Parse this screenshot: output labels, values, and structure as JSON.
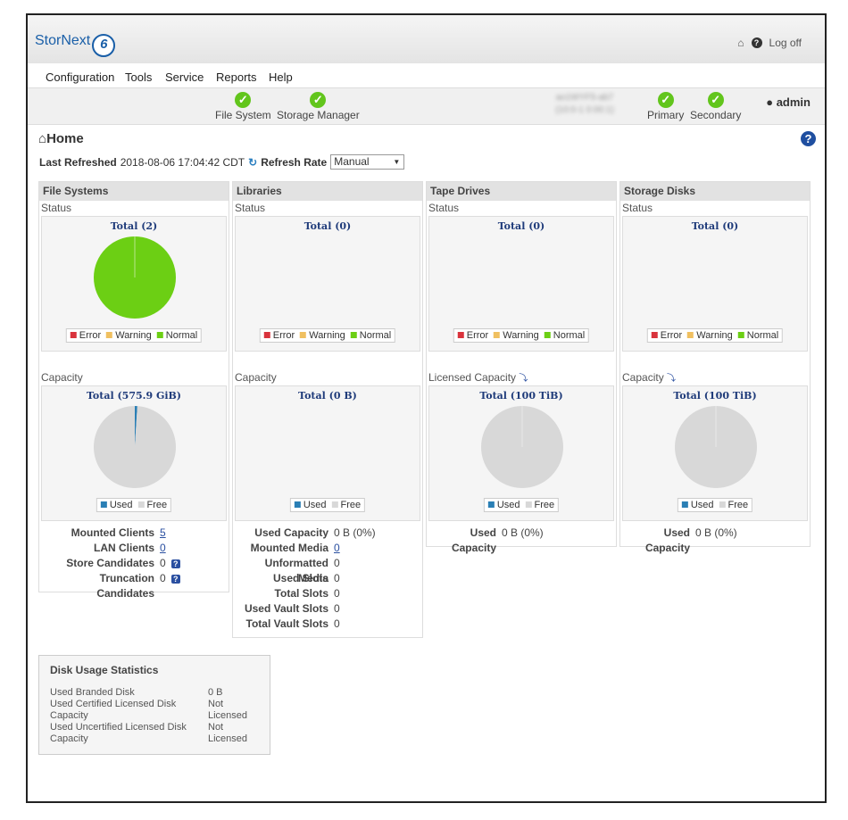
{
  "header": {
    "logo": "StorNext",
    "logo_badge": "6",
    "logoff": "Log off"
  },
  "menu": [
    "Configuration",
    "Tools",
    "Service",
    "Reports",
    "Help"
  ],
  "status": {
    "left": [
      "File System",
      "Storage Manager"
    ],
    "blurred_1": "ao1WYF5-ab7",
    "blurred_2": "(10:0-1 0:00:1)",
    "right": [
      "Primary",
      "Secondary"
    ],
    "user": "admin"
  },
  "page": {
    "title": "Home",
    "last_refreshed_label": "Last Refreshed",
    "last_refreshed": "2018-08-06 17:04:42 CDT",
    "refresh_rate_label": "Refresh Rate",
    "refresh_rate": "Manual"
  },
  "legends": {
    "error": "Error",
    "warning": "Warning",
    "normal": "Normal",
    "used": "Used",
    "free": "Free"
  },
  "colors": {
    "error": "#d9333c",
    "warning": "#f0c060",
    "normal": "#6ccf14",
    "used": "#2a7fb5",
    "free": "#d8d8d8"
  },
  "panels": [
    {
      "title": "File Systems",
      "status_label": "Status",
      "status_total": "Total (2)",
      "capacity_label": "Capacity",
      "capacity_total": "Total (575.9 GiB)",
      "stats": [
        {
          "k": "Mounted Clients",
          "v": "5",
          "link": true
        },
        {
          "k": "LAN Clients",
          "v": "0",
          "link": true
        },
        {
          "k": "Store Candidates",
          "v": "0",
          "help": true
        },
        {
          "k": "Truncation Candidates",
          "v": "0",
          "help": true
        }
      ]
    },
    {
      "title": "Libraries",
      "status_label": "Status",
      "status_total": "Total (0)",
      "capacity_label": "Capacity",
      "capacity_total": "Total (0 B)",
      "stats": [
        {
          "k": "Used Capacity",
          "v": "0 B (0%)"
        },
        {
          "k": "Mounted Media",
          "v": "0",
          "link": true
        },
        {
          "k": "Unformatted Media",
          "v": "0"
        },
        {
          "k": "Used Slots",
          "v": "0"
        },
        {
          "k": "Total Slots",
          "v": "0"
        },
        {
          "k": "Used Vault Slots",
          "v": "0"
        },
        {
          "k": "Total Vault Slots",
          "v": "0"
        }
      ]
    },
    {
      "title": "Tape Drives",
      "status_label": "Status",
      "status_total": "Total (0)",
      "capacity_label": "Licensed Capacity",
      "capacity_total": "Total (100 TiB)",
      "stats": [
        {
          "k": "Used Capacity",
          "v": "0 B (0%)"
        }
      ]
    },
    {
      "title": "Storage Disks",
      "status_label": "Status",
      "status_total": "Total (0)",
      "capacity_label": "Capacity",
      "capacity_total": "Total (100 TiB)",
      "stats": [
        {
          "k": "Used Capacity",
          "v": "0 B (0%)"
        }
      ]
    }
  ],
  "chart_data": [
    {
      "type": "pie",
      "title": "Total (2)",
      "categories": [
        "Error",
        "Warning",
        "Normal"
      ],
      "values": [
        0,
        0,
        2
      ]
    },
    {
      "type": "pie",
      "title": "Total (575.9 GiB)",
      "categories": [
        "Used",
        "Free"
      ],
      "values": [
        1,
        99
      ]
    },
    {
      "type": "pie",
      "title": "Total (100 TiB)",
      "categories": [
        "Used",
        "Free"
      ],
      "values": [
        0,
        100
      ]
    },
    {
      "type": "pie",
      "title": "Total (100 TiB)",
      "categories": [
        "Used",
        "Free"
      ],
      "values": [
        0,
        100
      ]
    }
  ],
  "disk_usage": {
    "title": "Disk Usage Statistics",
    "rows": [
      {
        "k": "Used Branded Disk",
        "v": "0 B"
      },
      {
        "k": "Used Certified Licensed Disk Capacity",
        "v": "Not Licensed"
      },
      {
        "k": "Used Uncertified Licensed Disk Capacity",
        "v": "Not Licensed"
      }
    ]
  }
}
